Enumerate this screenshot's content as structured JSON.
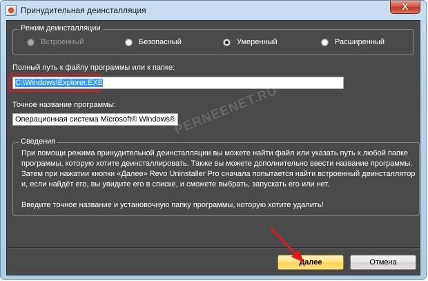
{
  "window": {
    "title": "Принудительная деинсталляция",
    "close_glyph": "X"
  },
  "mode_group": {
    "legend": "Режим деинсталляции",
    "options": [
      {
        "label": "Встроенный",
        "state": "disabled"
      },
      {
        "label": "Безопасный",
        "state": "unchecked"
      },
      {
        "label": "Умеренный",
        "state": "checked"
      },
      {
        "label": "Расширенный",
        "state": "unchecked"
      }
    ]
  },
  "path_field": {
    "label": "Полный путь к файлу программы или к папке:",
    "value": "C:\\Windows\\Explorer.EXE"
  },
  "name_field": {
    "label": "Точное название программы:",
    "value": "Операционная система Microsoft® Windows®"
  },
  "info_group": {
    "legend": "Сведения",
    "paragraph1": "При помощи режима принудительной деинсталляции вы можете найти файл или указать путь к любой папке программы, которую хотите деинсталлировать. Также вы можете дополнительно ввести название программы. Затем при нажатии кнопки «Далее» Revo Uninstaller Pro сначала попытается найти встроенный деинсталлятор и, если найдёт его, вы увидите его в списке, и сможете выбрать, запускать его или нет.",
    "paragraph2": "Введите точное название и установочную папку программы, которую хотите удалить!"
  },
  "watermark": "PERNEENET.RU",
  "buttons": {
    "next": "Далее",
    "cancel": "Отмена"
  },
  "colors": {
    "panel": "#4a4a4a",
    "highlight": "#e01818",
    "selection": "#3399ff",
    "primary_button": "#ffd24a"
  }
}
